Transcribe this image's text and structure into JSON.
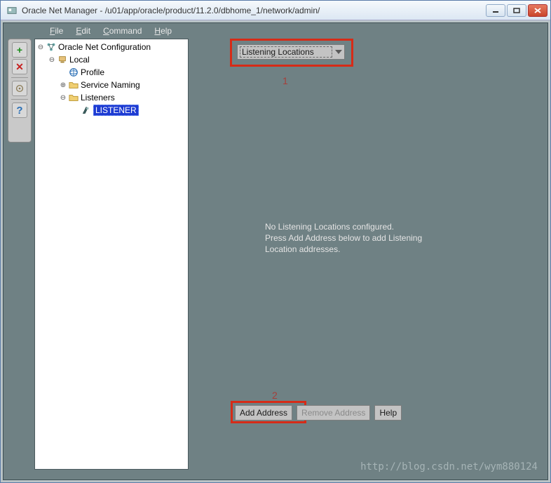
{
  "window": {
    "title": "Oracle Net Manager - /u01/app/oracle/product/11.2.0/dbhome_1/network/admin/"
  },
  "menu": {
    "file": "File",
    "edit": "Edit",
    "command": "Command",
    "help": "Help"
  },
  "tree": {
    "root": "Oracle Net Configuration",
    "local": "Local",
    "profile": "Profile",
    "service_naming": "Service Naming",
    "listeners": "Listeners",
    "listener_item": "LISTENER"
  },
  "dropdown": {
    "selected": "Listening Locations"
  },
  "status": {
    "line1": "No Listening Locations configured.",
    "line2": "Press Add Address below to add Listening",
    "line3": "Location addresses."
  },
  "buttons": {
    "add_address": "Add Address",
    "remove_address": "Remove Address",
    "help": "Help"
  },
  "annotations": {
    "one": "1",
    "two": "2"
  },
  "watermark": "http://blog.csdn.net/wym880124"
}
